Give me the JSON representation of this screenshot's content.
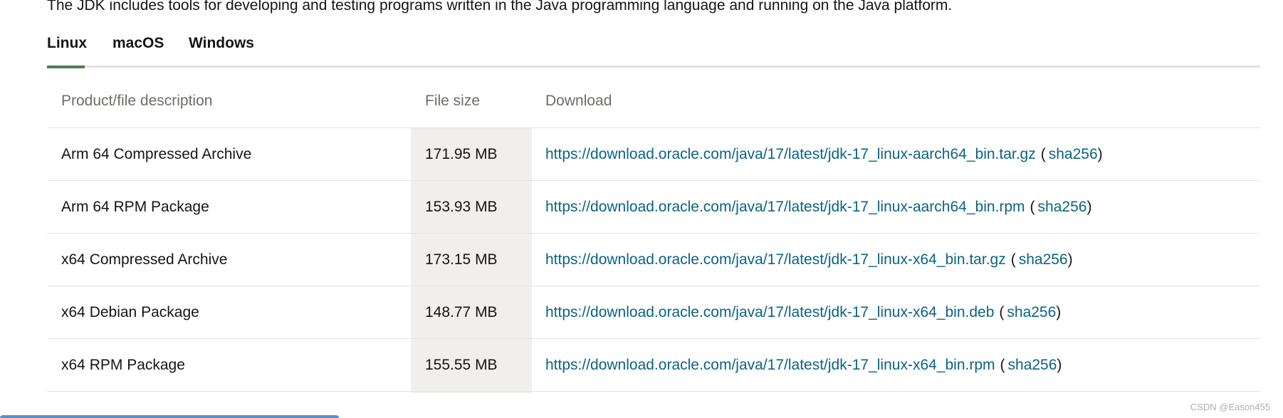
{
  "intro_text": "The JDK includes tools for developing and testing programs written in the Java programming language and running on the Java platform.",
  "tabs": [
    {
      "label": "Linux",
      "active": true
    },
    {
      "label": "macOS",
      "active": false
    },
    {
      "label": "Windows",
      "active": false
    }
  ],
  "table": {
    "headers": {
      "description": "Product/file description",
      "size": "File size",
      "download": "Download"
    },
    "rows": [
      {
        "description": "Arm 64 Compressed Archive",
        "size": "171.95 MB",
        "url": "https://download.oracle.com/java/17/latest/jdk-17_linux-aarch64_bin.tar.gz",
        "checksum": "sha256"
      },
      {
        "description": "Arm 64 RPM Package",
        "size": "153.93 MB",
        "url": "https://download.oracle.com/java/17/latest/jdk-17_linux-aarch64_bin.rpm",
        "checksum": "sha256"
      },
      {
        "description": "x64 Compressed Archive",
        "size": "173.15 MB",
        "url": "https://download.oracle.com/java/17/latest/jdk-17_linux-x64_bin.tar.gz",
        "checksum": "sha256"
      },
      {
        "description": "x64 Debian Package",
        "size": "148.77 MB",
        "url": "https://download.oracle.com/java/17/latest/jdk-17_linux-x64_bin.deb",
        "checksum": "sha256"
      },
      {
        "description": "x64 RPM Package",
        "size": "155.55 MB",
        "url": "https://download.oracle.com/java/17/latest/jdk-17_linux-x64_bin.rpm",
        "checksum": "sha256"
      }
    ]
  },
  "paren_open": "(",
  "paren_close": ")",
  "watermark": "CSDN @Eason455",
  "colors": {
    "link": "#0b6383",
    "tab_indicator": "#4f7c57",
    "file_size_bg": "#f1efed"
  }
}
